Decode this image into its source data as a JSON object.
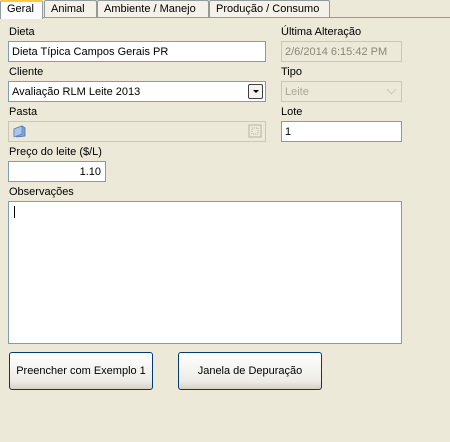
{
  "tabs": [
    "Geral",
    "Animal",
    "Ambiente / Manejo",
    "Produção / Consumo"
  ],
  "dieta": {
    "label": "Dieta",
    "value": "Dieta Típica Campos Gerais PR"
  },
  "ultima_alteracao": {
    "label": "Última Alteração",
    "value": "2/6/2014 6:15:42 PM"
  },
  "cliente": {
    "label": "Cliente",
    "value": "Avaliação RLM Leite 2013"
  },
  "tipo": {
    "label": "Tipo",
    "value": "Leite"
  },
  "pasta": {
    "label": "Pasta",
    "value": ""
  },
  "lote": {
    "label": "Lote",
    "value": "1"
  },
  "preco_leite": {
    "label": "Preço do leite ($/L)",
    "value": "1.10"
  },
  "observacoes": {
    "label": "Observações",
    "value": ""
  },
  "buttons": {
    "exemplo": "Preencher com Exemplo 1",
    "depuracao": "Janela de Depuração"
  },
  "icons": {
    "folder": "folder-icon",
    "browse": "browse-icon",
    "dropdown": "dropdown-arrow-icon"
  }
}
